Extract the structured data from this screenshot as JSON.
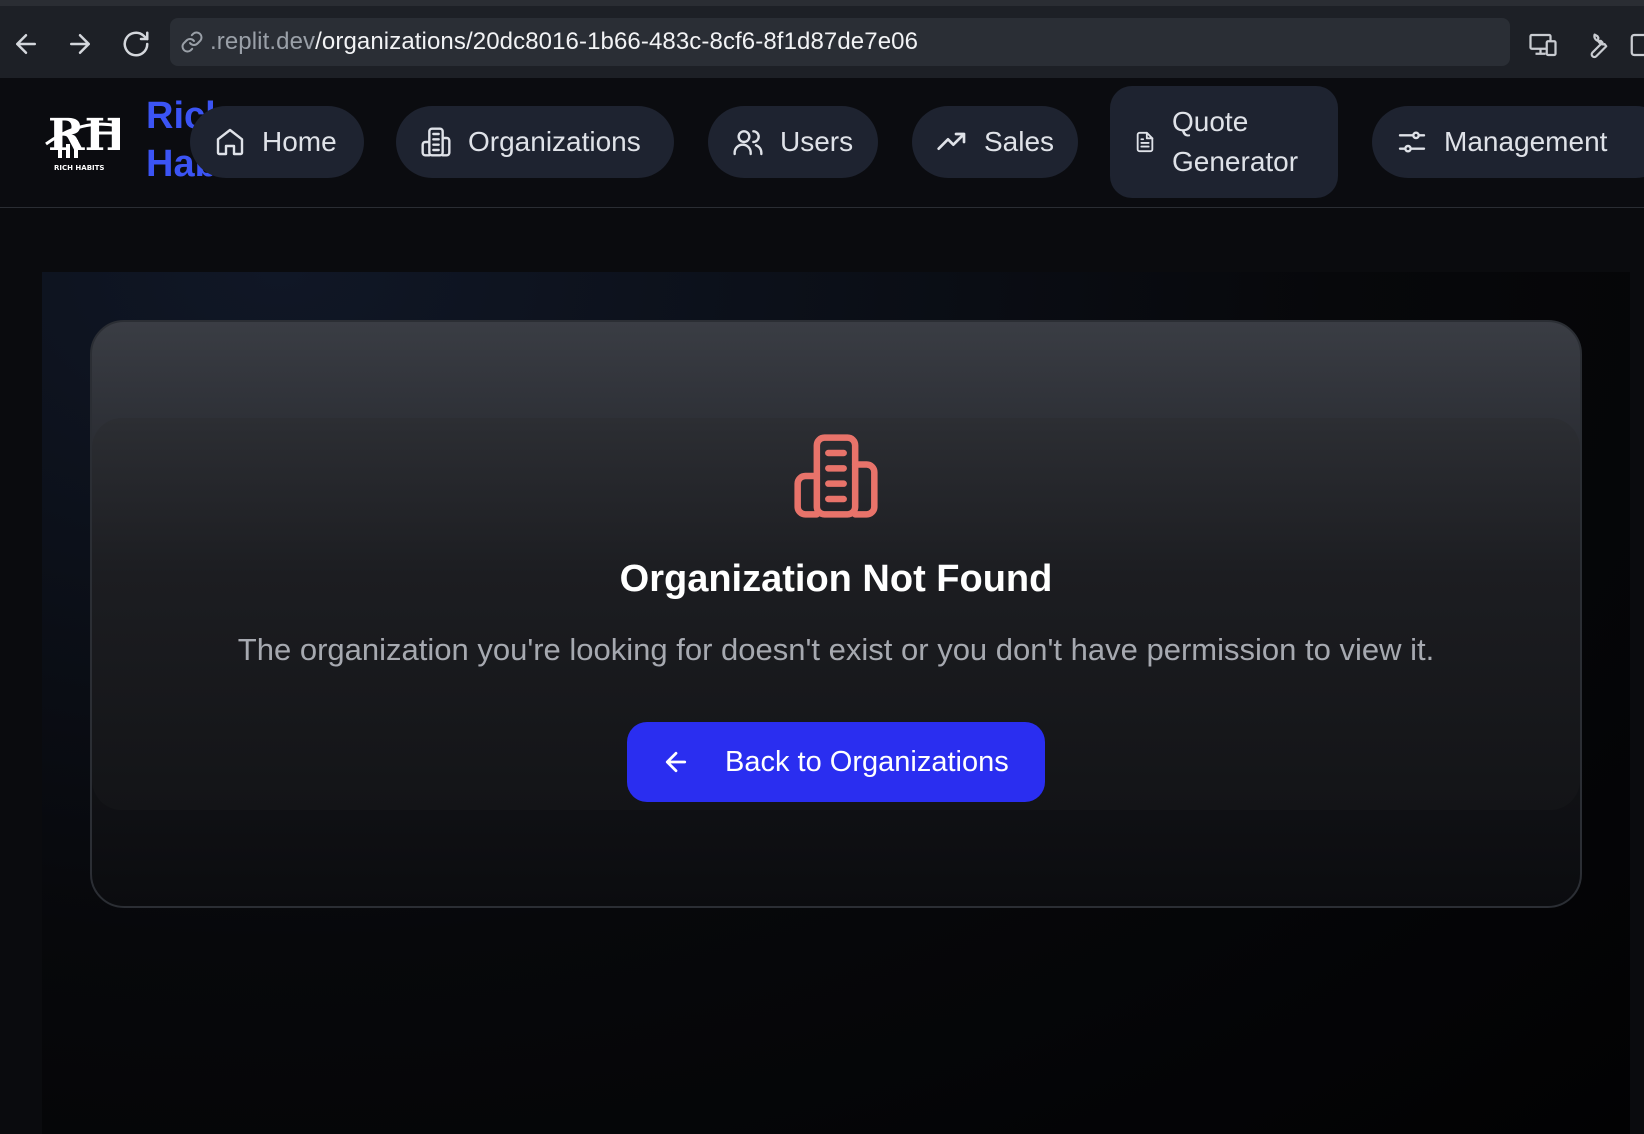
{
  "browser": {
    "url_host": ".replit.dev",
    "url_path": "/organizations/20dc8016-1b66-483c-8cf6-8f1d87de7e06"
  },
  "brand": {
    "name_line1": "Rich",
    "name_line2": "Habits",
    "logo_text": "RICH HABITS"
  },
  "nav": {
    "items": [
      {
        "label": "Home",
        "icon": "home-icon"
      },
      {
        "label": "Organizations",
        "icon": "building-icon"
      },
      {
        "label": "Users",
        "icon": "users-icon"
      },
      {
        "label": "Sales",
        "icon": "trending-up-icon"
      },
      {
        "label": "Quote Generator",
        "icon": "file-text-icon"
      },
      {
        "label": "Management",
        "icon": "sliders-icon"
      }
    ]
  },
  "not_found": {
    "title": "Organization Not Found",
    "description": "The organization you're looking for doesn't exist or you don't have permission to view it.",
    "back_label": "Back to Organizations",
    "icon": "building-icon"
  },
  "colors": {
    "accent": "#2a2ef0",
    "brand_blue": "#3b54f4",
    "error_icon": "#e8736a"
  }
}
